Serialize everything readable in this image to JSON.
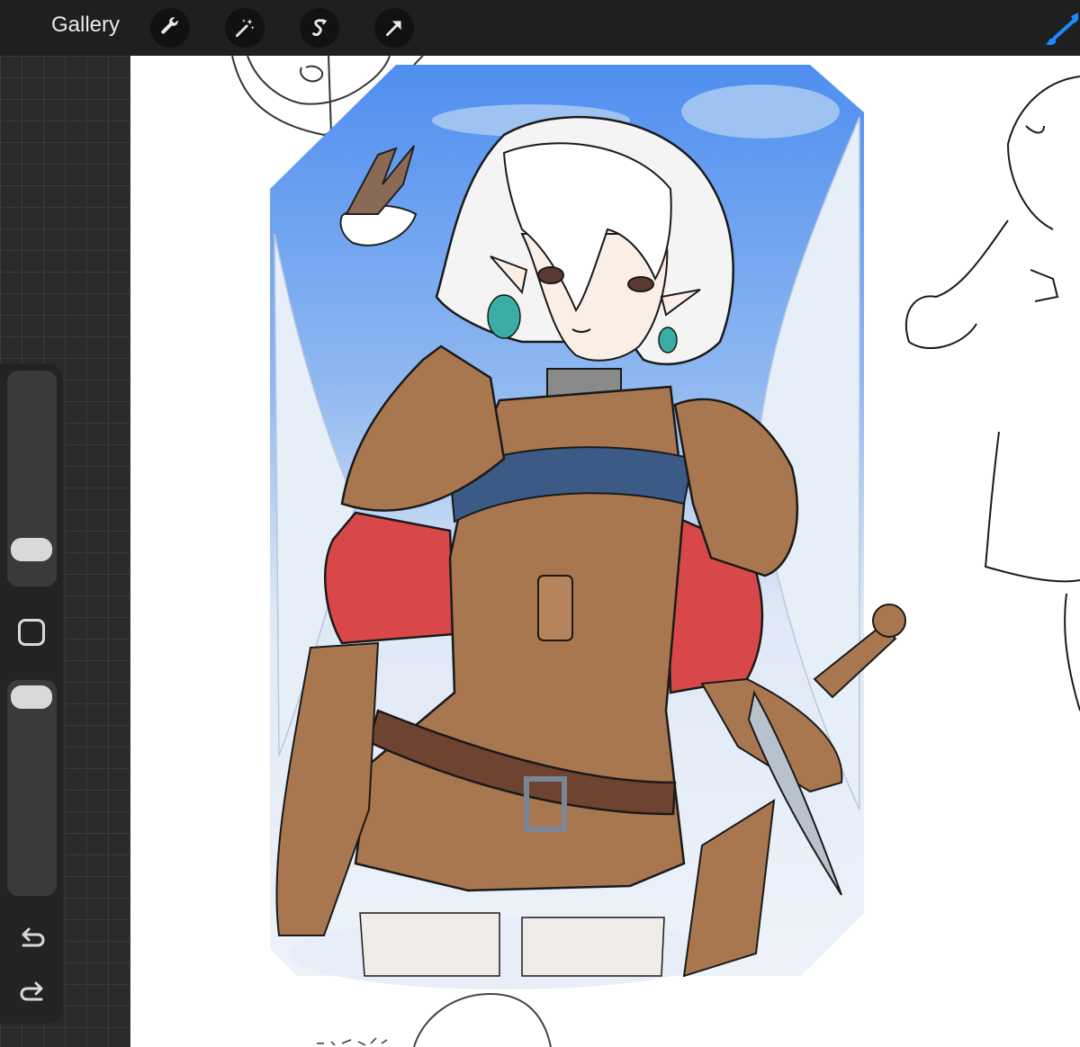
{
  "toolbar": {
    "gallery_label": "Gallery",
    "icons": [
      "wrench-icon",
      "magic-wand-icon",
      "selection-icon",
      "transform-arrow-icon",
      "brush-icon"
    ],
    "accent": "#1a8cff"
  },
  "sidebar": {
    "size_slider_level": 0.88,
    "opacity_slider_level": 0.0,
    "icons": [
      "square-modify-icon",
      "undo-icon",
      "redo-icon"
    ]
  },
  "canvas": {
    "colors": {
      "sky": "#6fa4f0",
      "armor": "#a8774f",
      "sleeve": "#d94848",
      "hair": "#f2f2f2",
      "earring": "#3aaea4",
      "line": "#1a1a1a"
    }
  }
}
